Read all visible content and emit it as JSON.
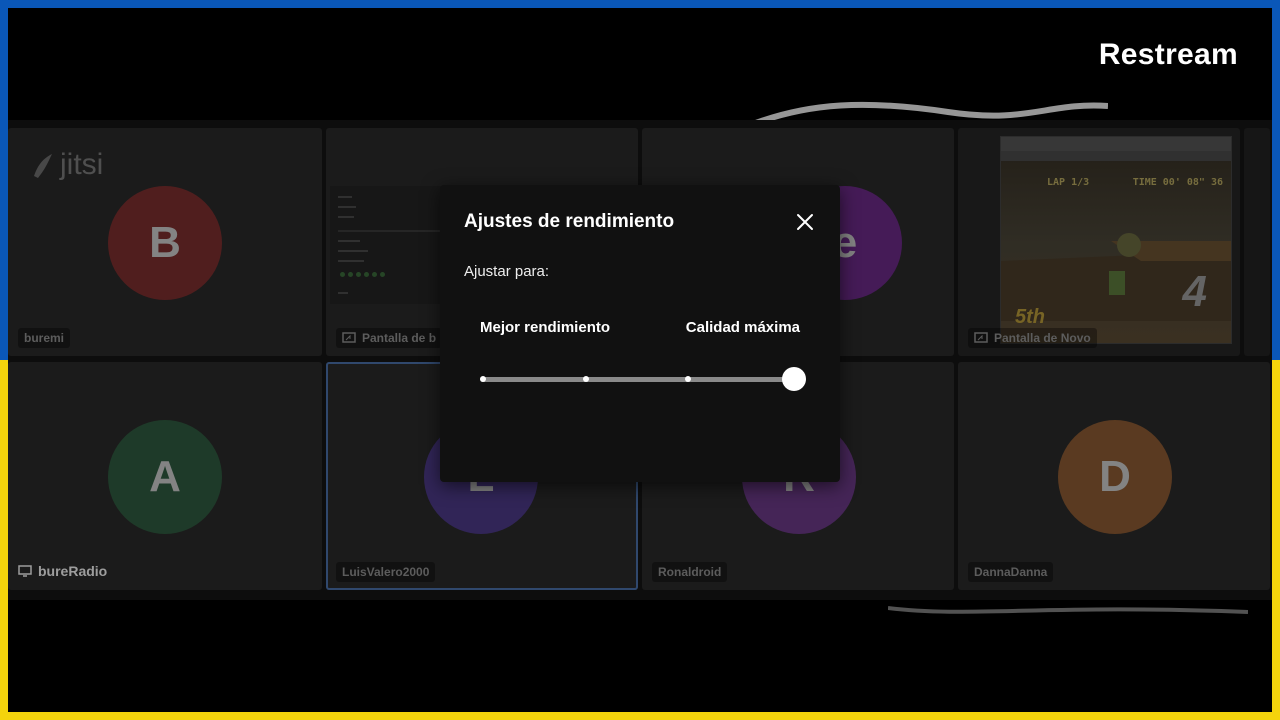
{
  "brand": "Restream",
  "jitsi_logo": "jitsi",
  "tiles": [
    {
      "name": "buremi",
      "avatar": "B",
      "avatar_color": "#7b2f2f"
    },
    {
      "name": "Pantalla de b"
    },
    {
      "name": "",
      "avatar": "e"
    },
    {
      "name": "Pantalla de Novo"
    },
    {
      "name": "bureRadio",
      "avatar": "A",
      "avatar_color": "#2f5a3f"
    },
    {
      "name": "LuisValero2000",
      "avatar": "L",
      "avatar_color": "#4c3a86"
    },
    {
      "name": "Ronaldroid",
      "avatar": "R",
      "avatar_color": "#6a3a86"
    },
    {
      "name": "DannaDanna",
      "avatar": "D",
      "avatar_color": "#8a5a33"
    }
  ],
  "game": {
    "lap": "LAP 1/3",
    "time": "TIME 00' 08\" 36",
    "position": "5th",
    "number": "4"
  },
  "modal": {
    "title": "Ajustes de rendimiento",
    "adjust_label": "Ajustar para:",
    "left_label": "Mejor rendimiento",
    "right_label": "Calidad máxima",
    "slider": {
      "steps": 4,
      "selected_index": 3
    }
  },
  "icons": {
    "close": "close-icon",
    "screen_share": "screen-share-icon",
    "desktop": "desktop-icon"
  },
  "colors": {
    "flag_blue": "#0a57b8",
    "flag_yellow": "#f4d40c"
  }
}
